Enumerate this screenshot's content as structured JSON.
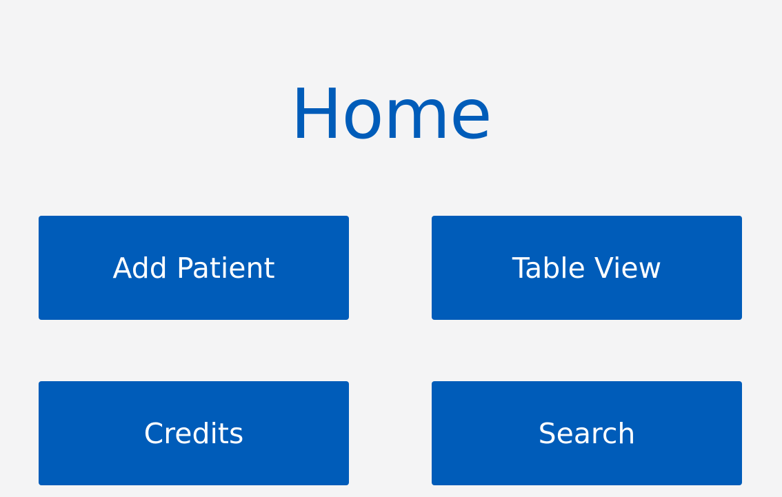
{
  "page": {
    "title": "Home",
    "background_color": "#f4f4f5",
    "accent_color": "#005cb9",
    "button_text_color": "#ffffff"
  },
  "buttons": {
    "add_patient": "Add Patient",
    "table_view": "Table View",
    "credits": "Credits",
    "search": "Search"
  }
}
